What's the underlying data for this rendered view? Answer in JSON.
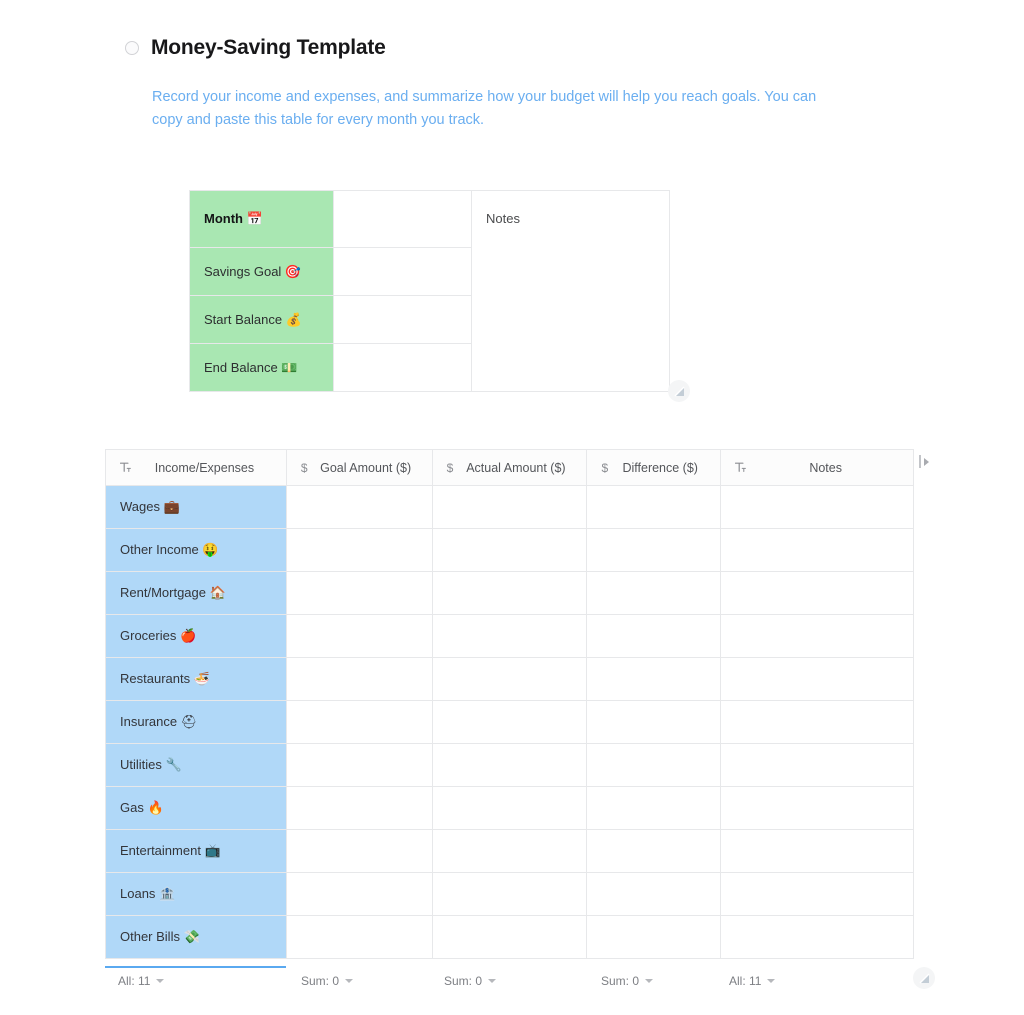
{
  "header": {
    "radio_icon": "radio-unchecked-icon",
    "title": "Money-Saving Template",
    "subtitle": "Record your income and expenses, and summarize how your budget will help you reach goals. You can copy and paste this table for every month you track."
  },
  "summary_table": {
    "notes_header": "Notes",
    "rows": [
      {
        "label": "Month 📅",
        "value": "",
        "notes": "Notes"
      },
      {
        "label": "Savings Goal 🎯",
        "value": "",
        "notes": ""
      },
      {
        "label": "Start Balance 💰",
        "value": "",
        "notes": ""
      },
      {
        "label": "End Balance 💵",
        "value": "",
        "notes": ""
      }
    ],
    "resize_handle_icon": "resize-corner-icon"
  },
  "budget_table": {
    "columns": [
      {
        "icon": "text-type-icon",
        "icon_glyph": "T",
        "label": "Income/Expenses"
      },
      {
        "icon": "currency-type-icon",
        "icon_glyph": "$",
        "label": "Goal Amount ($)"
      },
      {
        "icon": "currency-type-icon",
        "icon_glyph": "$",
        "label": "Actual Amount ($)"
      },
      {
        "icon": "currency-type-icon",
        "icon_glyph": "$",
        "label": "Difference ($)"
      },
      {
        "icon": "text-type-icon",
        "icon_glyph": "T",
        "label": "Notes"
      }
    ],
    "rows": [
      {
        "label": "Wages 💼",
        "goal": "",
        "actual": "",
        "difference": "",
        "notes": ""
      },
      {
        "label": "Other Income 🤑",
        "goal": "",
        "actual": "",
        "difference": "",
        "notes": ""
      },
      {
        "label": "Rent/Mortgage 🏠",
        "goal": "",
        "actual": "",
        "difference": "",
        "notes": ""
      },
      {
        "label": "Groceries 🍎",
        "goal": "",
        "actual": "",
        "difference": "",
        "notes": ""
      },
      {
        "label": "Restaurants 🍜",
        "goal": "",
        "actual": "",
        "difference": "",
        "notes": ""
      },
      {
        "label": "Insurance ⛑",
        "goal": "",
        "actual": "",
        "difference": "",
        "notes": ""
      },
      {
        "label": "Utilities 🔧",
        "goal": "",
        "actual": "",
        "difference": "",
        "notes": ""
      },
      {
        "label": "Gas 🔥",
        "goal": "",
        "actual": "",
        "difference": "",
        "notes": ""
      },
      {
        "label": "Entertainment 📺",
        "goal": "",
        "actual": "",
        "difference": "",
        "notes": ""
      },
      {
        "label": "Loans 🏦",
        "goal": "",
        "actual": "",
        "difference": "",
        "notes": ""
      },
      {
        "label": "Other Bills 💸",
        "goal": "",
        "actual": "",
        "difference": "",
        "notes": ""
      }
    ],
    "column_expand_icon": "column-expand-icon",
    "aggregates": [
      {
        "label": "All: 11"
      },
      {
        "label": "Sum: 0"
      },
      {
        "label": "Sum: 0"
      },
      {
        "label": "Sum: 0"
      },
      {
        "label": "All: 11"
      }
    ],
    "resize_handle_icon": "resize-corner-icon"
  },
  "colors": {
    "summary_label_bg": "#a9e7b2",
    "budget_label_bg": "#b0d8f8",
    "subtitle": "#6aaef0",
    "accent_underline": "#5aa9f0"
  }
}
